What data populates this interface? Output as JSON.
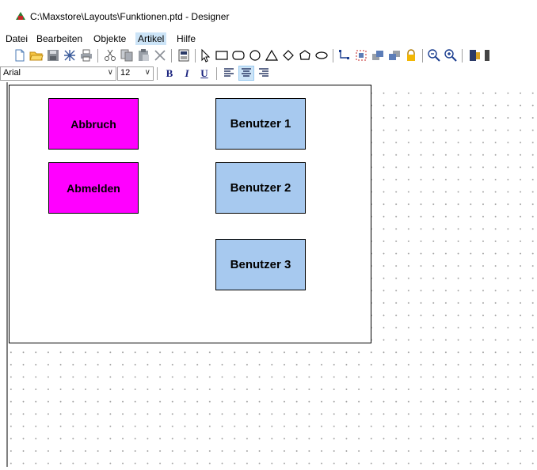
{
  "window": {
    "title": "C:\\Maxstore\\Layouts\\Funktionen.ptd - Designer",
    "app_icon": "designer-app-icon"
  },
  "menu": {
    "items": [
      "Datei",
      "Bearbeiten",
      "Objekte",
      "Artikel",
      "Hilfe"
    ],
    "active": "Artikel"
  },
  "toolbar": {
    "icons": [
      "new-file-icon",
      "open-folder-icon",
      "save-icon",
      "properties-icon",
      "print-icon",
      "cut-icon",
      "copy-icon",
      "paste-icon",
      "delete-icon",
      "page-icon",
      "pointer-icon",
      "rectangle-icon",
      "rounded-rectangle-icon",
      "ellipse-icon",
      "triangle-icon",
      "diamond-icon",
      "hexagon-icon",
      "oval-icon",
      "connector-icon",
      "select-region-icon",
      "bring-forward-icon",
      "send-backward-icon",
      "lock-icon",
      "zoom-out-icon",
      "zoom-in-icon",
      "exit-icon"
    ]
  },
  "format": {
    "font": "Arial",
    "size": "12",
    "bold_label": "B",
    "italic_label": "I",
    "underline_label": "U",
    "align_icons": [
      "align-left-icon",
      "align-center-icon",
      "align-right-icon"
    ],
    "active_align": "center"
  },
  "colors": {
    "magenta_button": "#ff00ff",
    "blue_button": "#a7c9ef",
    "menu_highlight": "#cce4f7"
  },
  "canvas": {
    "buttons": [
      {
        "label": "Abbruch",
        "color": "#ff00ff"
      },
      {
        "label": "Abmelden",
        "color": "#ff00ff"
      },
      {
        "label": "Benutzer 1",
        "color": "#a7c9ef"
      },
      {
        "label": "Benutzer 2",
        "color": "#a7c9ef"
      },
      {
        "label": "Benutzer 3",
        "color": "#a7c9ef"
      }
    ]
  }
}
